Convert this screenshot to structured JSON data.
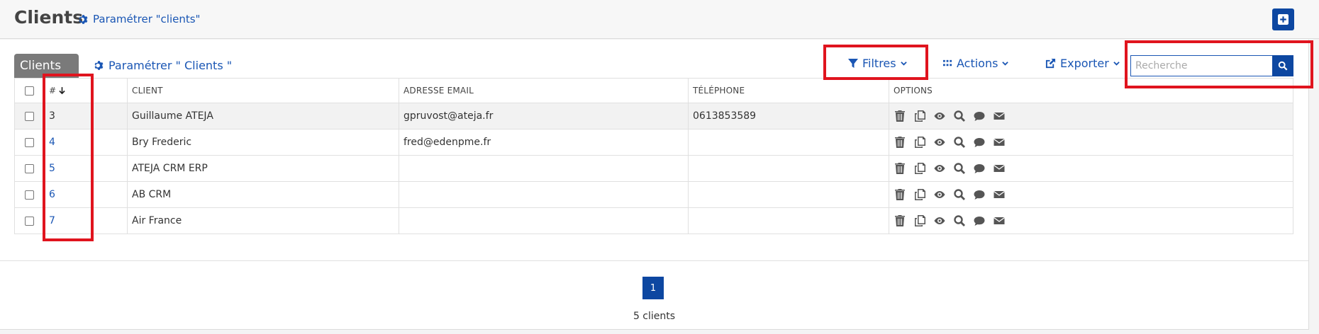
{
  "header": {
    "title": "Clients",
    "param_link": "Paramétrer \"clients\""
  },
  "toolbar": {
    "tab_label": "Clients",
    "param_link": "Paramétrer \" Clients \"",
    "filters_label": "Filtres",
    "actions_label": "Actions",
    "export_label": "Exporter",
    "search_placeholder": "Recherche"
  },
  "table": {
    "headers": [
      "#",
      "CLIENT",
      "ADRESSE EMAIL",
      "TÉLÉPHONE",
      "OPTIONS"
    ],
    "rows": [
      {
        "id": "3",
        "client": "Guillaume ATEJA",
        "email": "gpruvost@ateja.fr",
        "phone": "0613853589"
      },
      {
        "id": "4",
        "client": "Bry Frederic",
        "email": "fred@edenpme.fr",
        "phone": ""
      },
      {
        "id": "5",
        "client": "ATEJA CRM ERP",
        "email": "",
        "phone": ""
      },
      {
        "id": "6",
        "client": "AB CRM",
        "email": "",
        "phone": ""
      },
      {
        "id": "7",
        "client": "Air France",
        "email": "",
        "phone": ""
      }
    ],
    "row_option_icons": [
      "trash-icon",
      "copy-icon",
      "eye-icon",
      "search-icon",
      "comment-icon",
      "envelope-icon"
    ]
  },
  "pagination": {
    "current_page": "1",
    "count_text": "5 clients"
  },
  "colors": {
    "accent": "#0d47a1",
    "link": "#1a56b4",
    "highlight": "#e0141e",
    "tab": "#7a7a7a"
  }
}
